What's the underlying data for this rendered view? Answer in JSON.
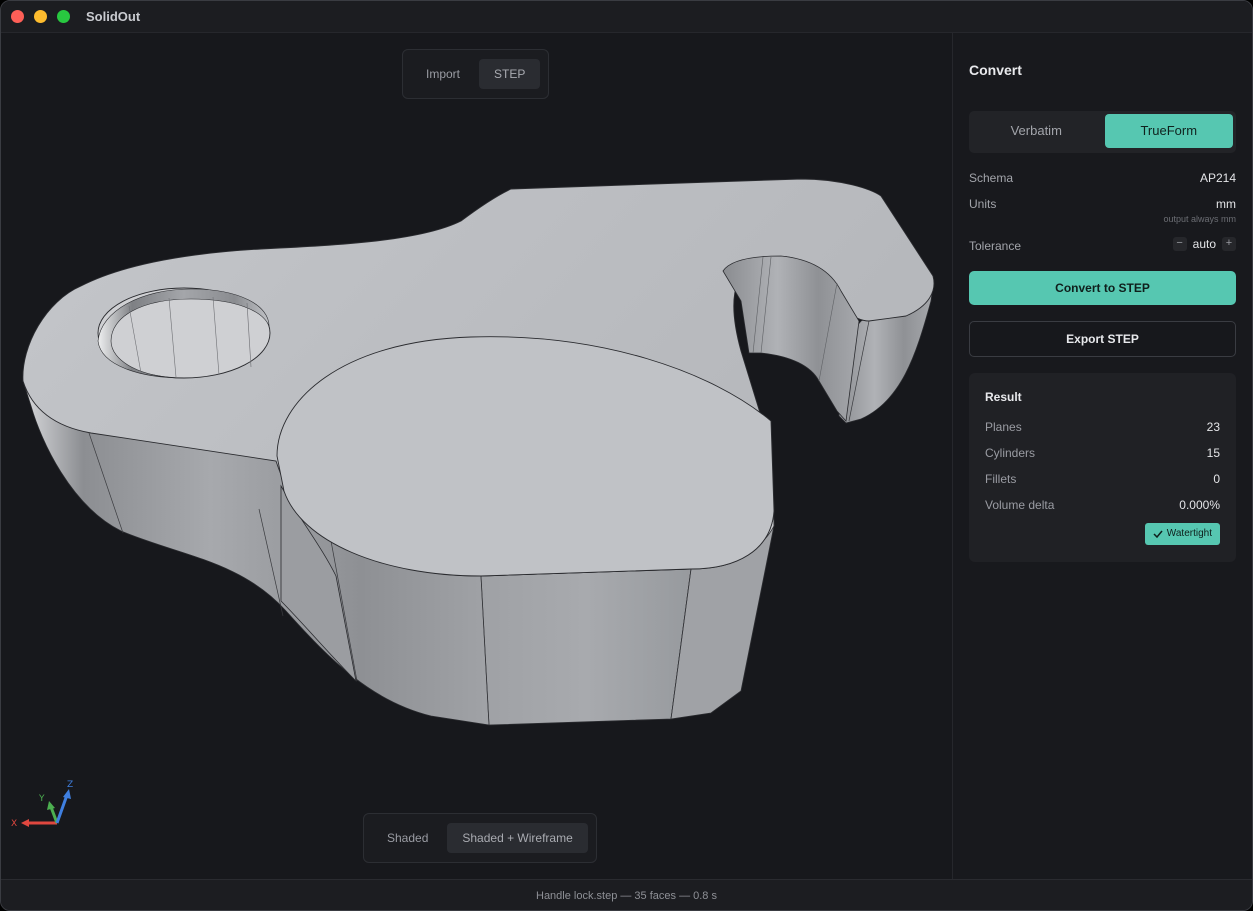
{
  "app": {
    "title": "SolidOut"
  },
  "viewport": {
    "source_tabs": [
      {
        "label": "Import",
        "active": false
      },
      {
        "label": "STEP",
        "active": true
      }
    ],
    "view_modes": [
      {
        "label": "Shaded",
        "active": false
      },
      {
        "label": "Shaded + Wireframe",
        "active": true
      }
    ],
    "axes": {
      "x": "X",
      "y": "Y",
      "z": "Z"
    }
  },
  "panel": {
    "title": "Convert",
    "modes": [
      {
        "label": "Verbatim",
        "active": false
      },
      {
        "label": "TrueForm",
        "active": true
      }
    ],
    "schema": {
      "label": "Schema",
      "value": "AP214"
    },
    "units": {
      "label": "Units",
      "value": "mm",
      "hint": "output always mm"
    },
    "tolerance": {
      "label": "Tolerance",
      "value": "auto",
      "minus": "−",
      "plus": "+"
    },
    "convert_button": "Convert to STEP",
    "export_button": "Export STEP",
    "result": {
      "title": "Result",
      "rows": [
        {
          "label": "Planes",
          "value": "23"
        },
        {
          "label": "Cylinders",
          "value": "15"
        },
        {
          "label": "Fillets",
          "value": "0"
        },
        {
          "label": "Volume delta",
          "value": "0.000%"
        }
      ],
      "badge": "Watertight"
    }
  },
  "status": {
    "text": "Handle lock.step — 35 faces — 0.8 s"
  },
  "colors": {
    "accent": "#56c7b1",
    "axis_x": "#e0473f",
    "axis_y": "#4caf50",
    "axis_z": "#3f7fe0"
  }
}
